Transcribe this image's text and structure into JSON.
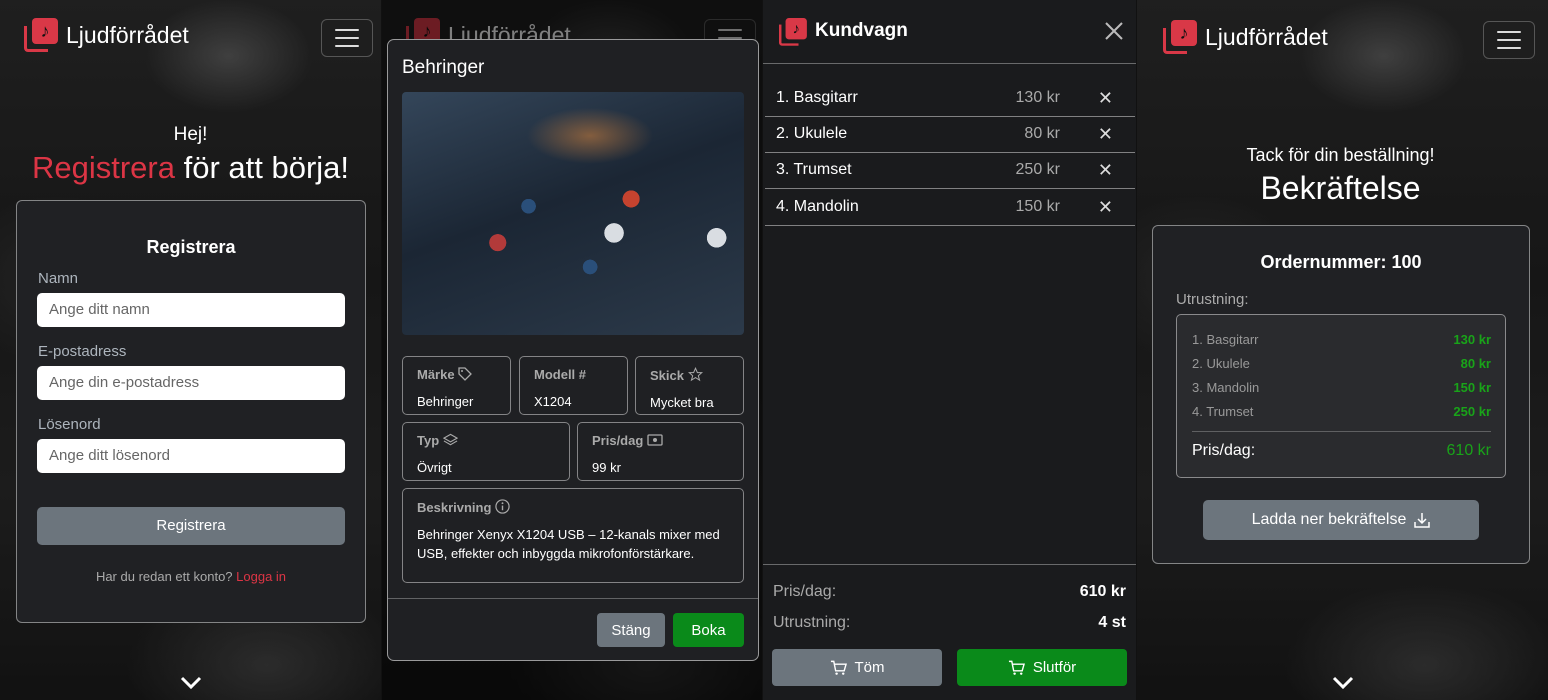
{
  "brand": {
    "name": "Ljudförrådet",
    "logo_glyph": "♪",
    "accent": "#dc3545"
  },
  "register": {
    "greeting": "Hej!",
    "headline_red": "Registrera",
    "headline_rest": " för att börja!",
    "form_title": "Registrera",
    "name_label": "Namn",
    "name_placeholder": "Ange ditt namn",
    "email_label": "E-postadress",
    "email_placeholder": "Ange din e-postadress",
    "password_label": "Lösenord",
    "password_placeholder": "Ange ditt lösenord",
    "submit_label": "Registrera",
    "login_prompt": "Har du redan ett konto?",
    "login_link": "Logga in"
  },
  "product": {
    "title": "Behringer",
    "brand_label": "Märke",
    "brand_value": "Behringer",
    "model_label": "Modell",
    "model_icon": "#",
    "model_value": "X1204",
    "condition_label": "Skick",
    "condition_value": "Mycket bra",
    "type_label": "Typ",
    "type_value": "Övrigt",
    "price_label": "Pris/dag",
    "price_value": "99 kr",
    "description_label": "Beskrivning",
    "description": "Behringer Xenyx X1204 USB – 12-kanals mixer med USB, effekter och inbyggda mikrofonförstärkare.",
    "close_label": "Stäng",
    "book_label": "Boka"
  },
  "cart": {
    "title": "Kundvagn",
    "items": [
      {
        "name": "1. Basgitarr",
        "price": "130 kr"
      },
      {
        "name": "2. Ukulele",
        "price": "80 kr"
      },
      {
        "name": "3. Trumset",
        "price": "250 kr"
      },
      {
        "name": "4. Mandolin",
        "price": "150 kr"
      }
    ],
    "remove_glyph": "✕",
    "price_label": "Pris/dag:",
    "price_total": "610 kr",
    "equipment_label": "Utrustning:",
    "equipment_count": "4 st",
    "clear_label": "Töm",
    "checkout_label": "Slutför"
  },
  "confirmation": {
    "thanks": "Tack för din beställning!",
    "headline": "Bekräftelse",
    "order_label": "Ordernummer: 100",
    "equipment_label": "Utrustning:",
    "items": [
      {
        "name": "1. Basgitarr",
        "price": "130 kr"
      },
      {
        "name": "2. Ukulele",
        "price": "80 kr"
      },
      {
        "name": "3. Mandolin",
        "price": "150 kr"
      },
      {
        "name": "4. Trumset",
        "price": "250 kr"
      }
    ],
    "total_label": "Pris/dag:",
    "total_value": "610 kr",
    "download_label": "Ladda ner bekräftelse"
  },
  "colors": {
    "green": "#198754",
    "gray_button": "#6c757d"
  }
}
